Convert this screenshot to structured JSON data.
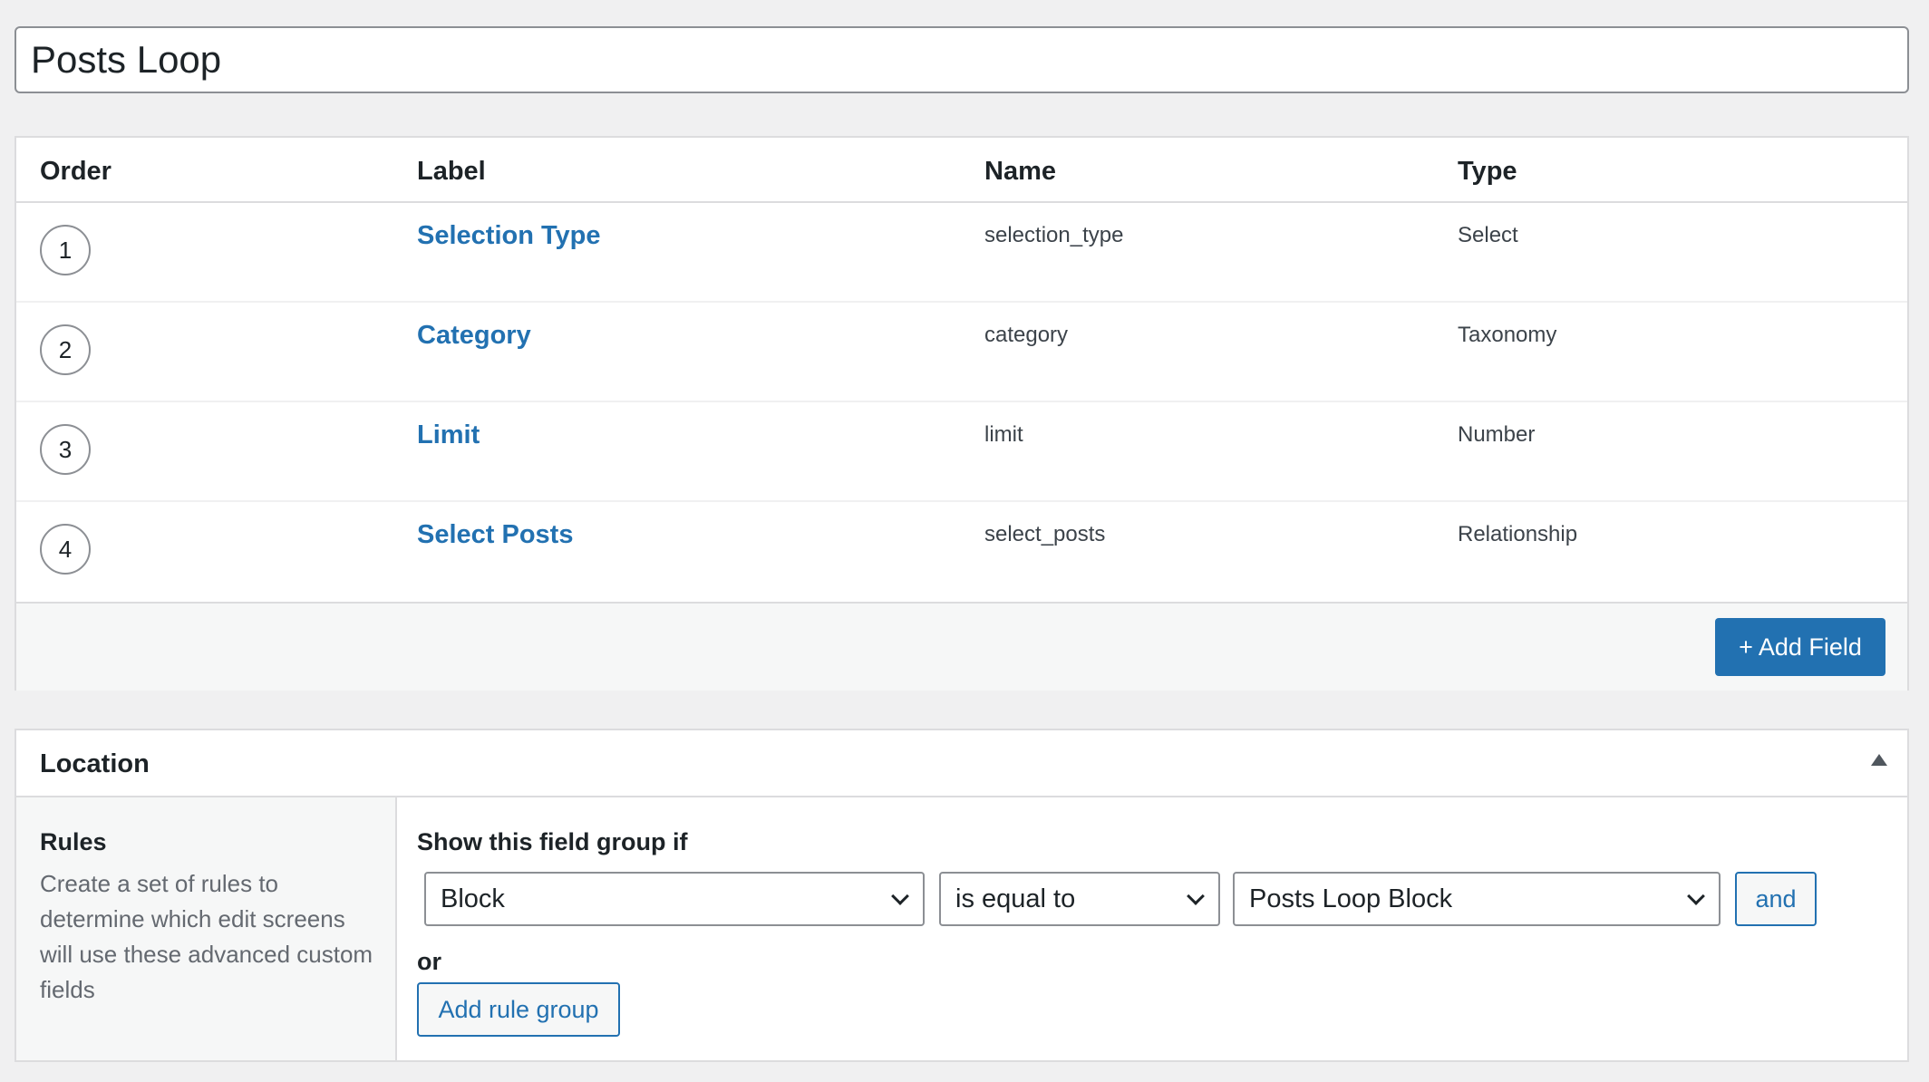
{
  "title_input": {
    "value": "Posts Loop"
  },
  "fields_table": {
    "headers": {
      "order": "Order",
      "label": "Label",
      "name": "Name",
      "type": "Type"
    },
    "rows": [
      {
        "order": "1",
        "label": "Selection Type",
        "name": "selection_type",
        "type": "Select"
      },
      {
        "order": "2",
        "label": "Category",
        "name": "category",
        "type": "Taxonomy"
      },
      {
        "order": "3",
        "label": "Limit",
        "name": "limit",
        "type": "Number"
      },
      {
        "order": "4",
        "label": "Select Posts",
        "name": "select_posts",
        "type": "Relationship"
      }
    ],
    "add_field_label": "+ Add Field"
  },
  "location": {
    "title": "Location",
    "rules_title": "Rules",
    "rules_description": "Create a set of rules to determine which edit screens will use these advanced custom fields",
    "show_if_label": "Show this field group if",
    "param_value": "Block",
    "operator_value": "is equal to",
    "target_value": "Posts Loop Block",
    "and_label": "and",
    "or_label": "or",
    "add_rule_group_label": "Add rule group"
  },
  "colors": {
    "accent": "#2271b1",
    "background": "#f0f0f1"
  }
}
